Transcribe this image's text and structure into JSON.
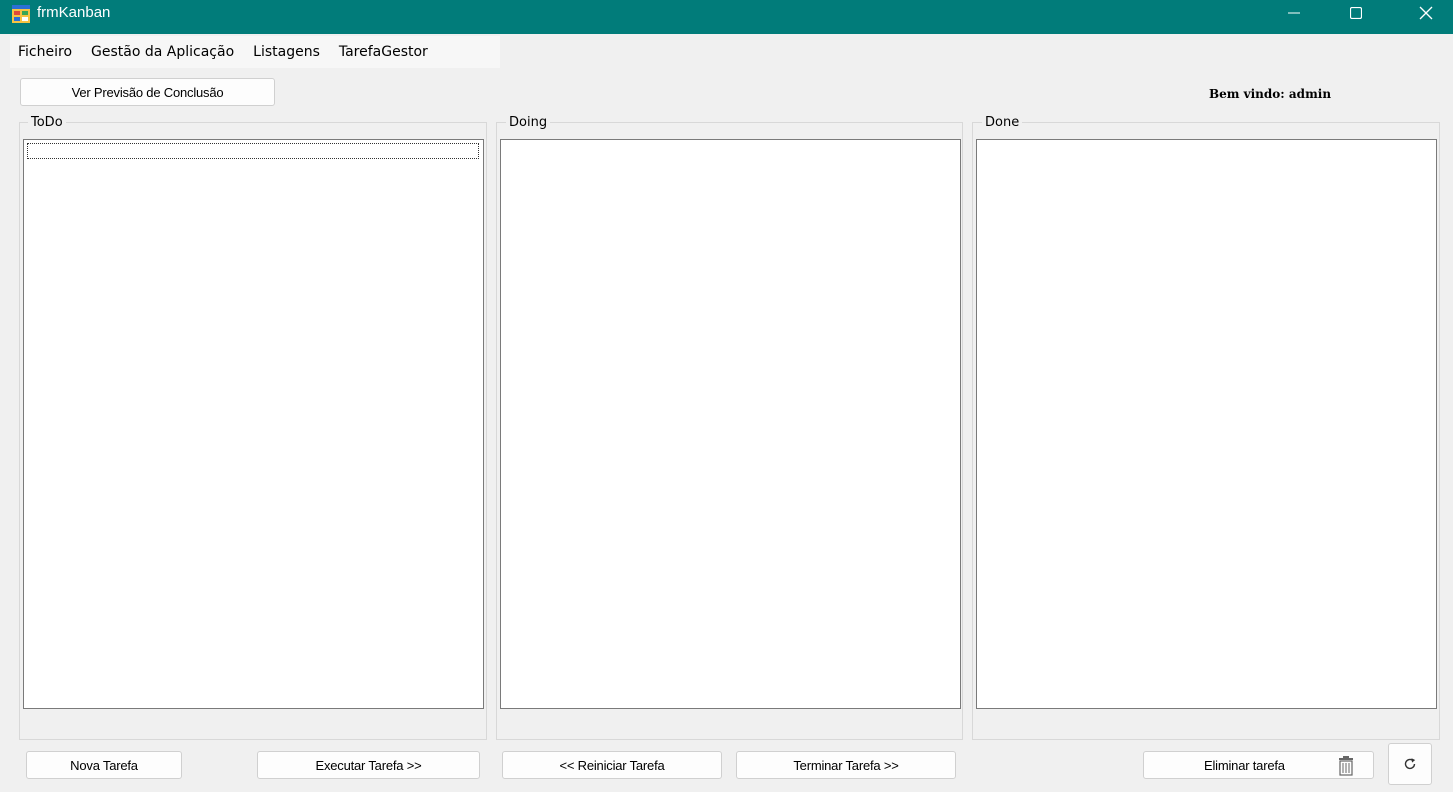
{
  "window": {
    "title": "frmKanban",
    "icon": "app-form-icon",
    "controls": [
      "minimize-icon",
      "maximize-icon",
      "close-icon"
    ]
  },
  "menu": {
    "items": [
      "Ficheiro",
      "Gestão da Aplicação",
      "Listagens",
      "TarefaGestor"
    ]
  },
  "toolbar": {
    "forecast_button": "Ver Previsão de Conclusão"
  },
  "welcome": "Bem vindo: admin",
  "columns": [
    {
      "label": "ToDo",
      "items": []
    },
    {
      "label": "Doing",
      "items": []
    },
    {
      "label": "Done",
      "items": []
    }
  ],
  "buttons": {
    "new_task": "Nova Tarefa",
    "execute_task": "Executar Tarefa >>",
    "restart_task": "<< Reiniciar Tarefa",
    "finish_task": "Terminar Tarefa >>",
    "delete_task": "Eliminar tarefa",
    "delete_icon": "trash-icon",
    "refresh_icon": "refresh-icon"
  },
  "colors": {
    "titlebar": "#017c7a",
    "background": "#f0f0f0"
  }
}
